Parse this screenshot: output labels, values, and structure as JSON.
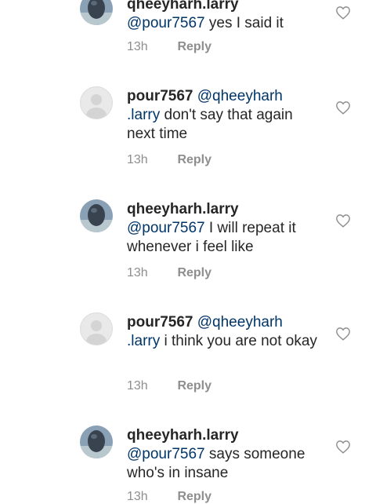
{
  "comments": [
    {
      "username": "qheeyharh.larry",
      "mention": "@pour7567",
      "text": " yes I said it",
      "time": "13h",
      "reply_label": "Reply",
      "avatar": "profile-photo"
    },
    {
      "username": "pour7567",
      "mention_first": "@qheeyharh",
      "mention_second": ".larry",
      "text": " don't say that again next time",
      "time": "13h",
      "reply_label": "Reply",
      "avatar": "default"
    },
    {
      "username": "qheeyharh.larry",
      "mention": "@pour7567",
      "text": " I will repeat it whenever i feel like",
      "time": "13h",
      "reply_label": "Reply",
      "avatar": "profile-photo"
    },
    {
      "username": "pour7567",
      "mention_first": "@qheeyharh",
      "mention_second": ".larry",
      "text": " i think you are not okay",
      "time": "13h",
      "reply_label": "Reply",
      "avatar": "default"
    },
    {
      "username": "qheeyharh.larry",
      "mention": "@pour7567",
      "text": " says someone who's in insane",
      "time": "13h",
      "reply_label": "Reply",
      "avatar": "profile-photo"
    }
  ],
  "icons": {
    "like": "heart-outline-icon"
  },
  "colors": {
    "mention": "#003569",
    "meta": "#8e8e8e",
    "text": "#262626"
  }
}
